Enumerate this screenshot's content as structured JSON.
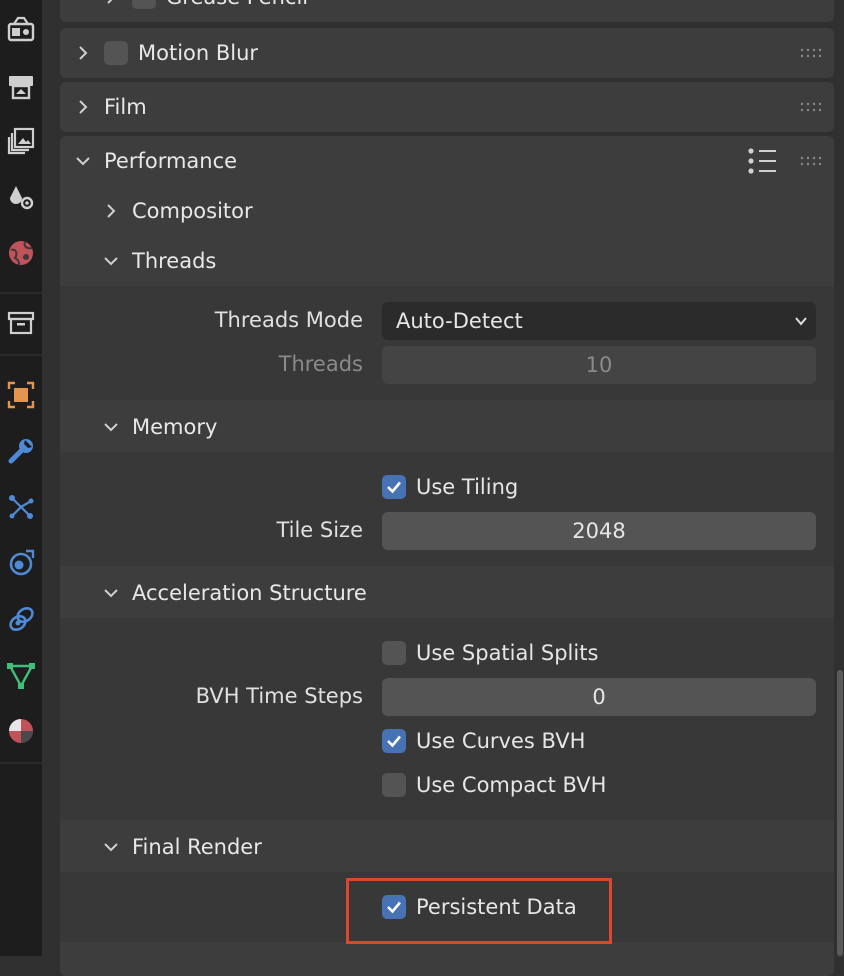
{
  "tabs": [
    {
      "icon": "render-icon",
      "color": "#cfcfcf"
    },
    {
      "icon": "output-icon",
      "color": "#cfcfcf"
    },
    {
      "icon": "view-layer-icon",
      "color": "#cfcfcf"
    },
    {
      "icon": "scene-icon",
      "color": "#cfcfcf"
    },
    {
      "icon": "world-icon",
      "color": "#c0525a"
    },
    {
      "icon": "collection-icon",
      "color": "#cfcfcf"
    },
    {
      "icon": "object-icon",
      "color": "#e3954e"
    },
    {
      "icon": "modifier-icon",
      "color": "#4f8ad6"
    },
    {
      "icon": "particles-icon",
      "color": "#4f8ad6"
    },
    {
      "icon": "physics-icon",
      "color": "#4f8ad6"
    },
    {
      "icon": "constraints-icon",
      "color": "#4f8ad6"
    },
    {
      "icon": "data-icon",
      "color": "#3fbf7a"
    },
    {
      "icon": "material-icon",
      "color": "#c0525a"
    }
  ],
  "panels": {
    "grease_pencil": {
      "label": "Grease Pencil"
    },
    "motion_blur": {
      "label": "Motion Blur",
      "checked": false
    },
    "film": {
      "label": "Film"
    },
    "performance": {
      "label": "Performance"
    }
  },
  "performance": {
    "compositor": {
      "label": "Compositor"
    },
    "threads": {
      "label": "Threads",
      "mode_label": "Threads Mode",
      "mode_value": "Auto-Detect",
      "threads_label": "Threads",
      "threads_value": "10"
    },
    "memory": {
      "label": "Memory",
      "use_tiling_label": "Use Tiling",
      "use_tiling": true,
      "tile_size_label": "Tile Size",
      "tile_size_value": "2048"
    },
    "acceleration": {
      "label": "Acceleration Structure",
      "spatial_splits_label": "Use Spatial Splits",
      "spatial_splits": false,
      "bvh_time_steps_label": "BVH Time Steps",
      "bvh_time_steps_value": "0",
      "curves_bvh_label": "Use Curves BVH",
      "curves_bvh": true,
      "compact_bvh_label": "Use Compact BVH",
      "compact_bvh": false
    },
    "final_render": {
      "label": "Final Render",
      "persistent_data_label": "Persistent Data",
      "persistent_data": true
    }
  },
  "highlight_color": "#e0452e",
  "checkbox_on_color": "#4772b3"
}
